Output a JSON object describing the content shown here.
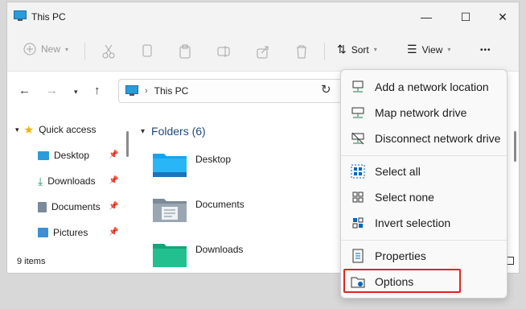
{
  "window": {
    "title": "This PC"
  },
  "window_controls": {
    "minimize": "—",
    "maximize": "☐",
    "close": "✕"
  },
  "toolbar": {
    "new_label": "New",
    "sort_label": "Sort",
    "view_label": "View",
    "more_label": "•••"
  },
  "address": {
    "path": "This PC"
  },
  "sidebar": {
    "items": [
      {
        "label": "Quick access",
        "icon": "star-icon"
      },
      {
        "label": "Desktop",
        "icon": "desktop-icon"
      },
      {
        "label": "Downloads",
        "icon": "download-icon"
      },
      {
        "label": "Documents",
        "icon": "document-icon"
      },
      {
        "label": "Pictures",
        "icon": "picture-icon"
      }
    ]
  },
  "content": {
    "group_title": "Folders (6)",
    "folders": [
      {
        "name": "Desktop"
      },
      {
        "name": "Documents"
      },
      {
        "name": "Downloads"
      }
    ]
  },
  "status": {
    "item_count": "9 items"
  },
  "context_menu": {
    "items": [
      {
        "label": "Add a network location",
        "icon": "network-location-icon"
      },
      {
        "label": "Map network drive",
        "icon": "map-drive-icon"
      },
      {
        "label": "Disconnect network drive",
        "icon": "disconnect-drive-icon"
      },
      {
        "label": "Select all",
        "icon": "select-all-icon"
      },
      {
        "label": "Select none",
        "icon": "select-none-icon"
      },
      {
        "label": "Invert selection",
        "icon": "invert-selection-icon"
      },
      {
        "label": "Properties",
        "icon": "properties-icon"
      },
      {
        "label": "Options",
        "icon": "options-icon"
      }
    ]
  },
  "colors": {
    "accent": "#0067c0",
    "highlight_border": "#e02424",
    "folder": "#1aa3e8"
  }
}
